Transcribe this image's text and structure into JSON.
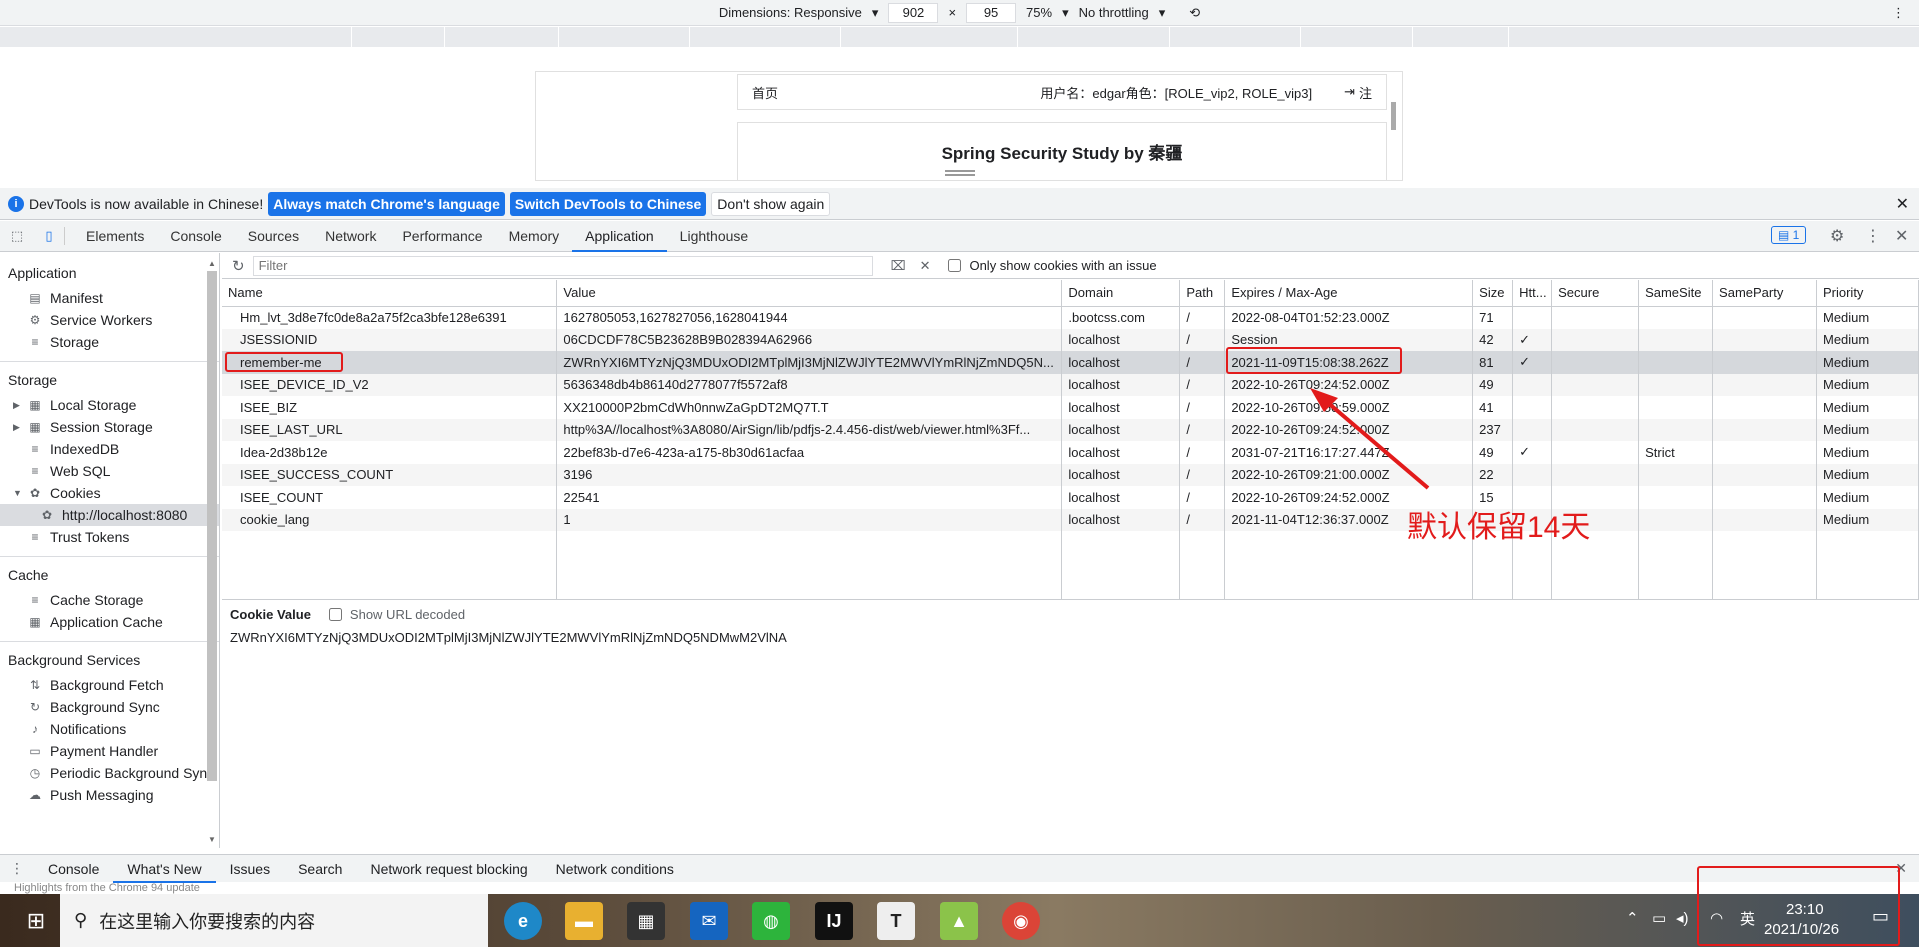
{
  "device_toolbar": {
    "dimensions_label": "Dimensions: Responsive",
    "width": "902",
    "height": "95",
    "times": "×",
    "zoom": "75%",
    "throttling": "No throttling"
  },
  "page": {
    "nav_home": "首页",
    "user_info": "用户名：edgar角色：[ROLE_vip2, ROLE_vip3]",
    "logout_partial": "注",
    "title": "Spring Security Study by 秦疆"
  },
  "infobar": {
    "message": "DevTools is now available in Chinese!",
    "btn_match": "Always match Chrome's language",
    "btn_switch": "Switch DevTools to Chinese",
    "btn_dont": "Don't show again"
  },
  "tabs": [
    "Elements",
    "Console",
    "Sources",
    "Network",
    "Performance",
    "Memory",
    "Application",
    "Lighthouse"
  ],
  "issues_badge": "1",
  "sidebar": {
    "application_header": "Application",
    "application_items": [
      "Manifest",
      "Service Workers",
      "Storage"
    ],
    "storage_header": "Storage",
    "storage_items": [
      "Local Storage",
      "Session Storage",
      "IndexedDB",
      "Web SQL",
      "Cookies"
    ],
    "cookie_origin": "http://localhost:8080",
    "trust_tokens": "Trust Tokens",
    "cache_header": "Cache",
    "cache_items": [
      "Cache Storage",
      "Application Cache"
    ],
    "bg_header": "Background Services",
    "bg_items": [
      "Background Fetch",
      "Background Sync",
      "Notifications",
      "Payment Handler",
      "Periodic Background Sync",
      "Push Messaging"
    ]
  },
  "filter": {
    "placeholder": "Filter",
    "only_issues": "Only show cookies with an issue"
  },
  "table": {
    "columns": [
      "Name",
      "Value",
      "Domain",
      "Path",
      "Expires / Max-Age",
      "Size",
      "Htt...",
      "Secure",
      "SameSite",
      "SameParty",
      "Priority"
    ],
    "rows": [
      [
        "Hm_lvt_3d8e7fc0de8a2a75f2ca3bfe128e6391",
        "1627805053,1627827056,1628041944",
        ".bootcss.com",
        "/",
        "2022-08-04T01:52:23.000Z",
        "71",
        "",
        "",
        "",
        "",
        "Medium"
      ],
      [
        "JSESSIONID",
        "06CDCDF78C5B23628B9B028394A62966",
        "localhost",
        "/",
        "Session",
        "42",
        "✓",
        "",
        "",
        "",
        "Medium"
      ],
      [
        "remember-me",
        "ZWRnYXI6MTYzNjQ3MDUxODI2MTplMjI3MjNlZWJlYTE2MWVlYmRlNjZmNDQ5N...",
        "localhost",
        "/",
        "2021-11-09T15:08:38.262Z",
        "81",
        "✓",
        "",
        "",
        "",
        "Medium"
      ],
      [
        "ISEE_DEVICE_ID_V2",
        "5636348db4b86140d2778077f5572af8",
        "localhost",
        "/",
        "2022-10-26T09:24:52.000Z",
        "49",
        "",
        "",
        "",
        "",
        "Medium"
      ],
      [
        "ISEE_BIZ",
        "XX210000P2bmCdWh0nnwZaGpDT2MQ7T.T",
        "localhost",
        "/",
        "2022-10-26T09:50:59.000Z",
        "41",
        "",
        "",
        "",
        "",
        "Medium"
      ],
      [
        "ISEE_LAST_URL",
        "http%3A//localhost%3A8080/AirSign/lib/pdfjs-2.4.456-dist/web/viewer.html%3Ff...",
        "localhost",
        "/",
        "2022-10-26T09:24:52.000Z",
        "237",
        "",
        "",
        "",
        "",
        "Medium"
      ],
      [
        "Idea-2d38b12e",
        "22bef83b-d7e6-423a-a175-8b30d61acfaa",
        "localhost",
        "/",
        "2031-07-21T16:17:27.447Z",
        "49",
        "✓",
        "",
        "Strict",
        "",
        "Medium"
      ],
      [
        "ISEE_SUCCESS_COUNT",
        "3196",
        "localhost",
        "/",
        "2022-10-26T09:21:00.000Z",
        "22",
        "",
        "",
        "",
        "",
        "Medium"
      ],
      [
        "ISEE_COUNT",
        "22541",
        "localhost",
        "/",
        "2022-10-26T09:24:52.000Z",
        "15",
        "",
        "",
        "",
        "",
        "Medium"
      ],
      [
        "cookie_lang",
        "1",
        "localhost",
        "/",
        "2021-11-04T12:36:37.000Z",
        "",
        "",
        "",
        "",
        "",
        "Medium"
      ]
    ]
  },
  "cookie_value": {
    "label": "Cookie Value",
    "show_decoded": "Show URL decoded",
    "value": "ZWRnYXI6MTYzNjQ3MDUxODI2MTplMjI3MjNlZWJlYTE2MWVlYmRlNjZmNDQ5NDMwM2VlNA"
  },
  "annotation": "默认保留14天",
  "drawer": {
    "tabs": [
      "Console",
      "What's New",
      "Issues",
      "Search",
      "Network request blocking",
      "Network conditions"
    ],
    "text": "Highlights from the Chrome 94 update"
  },
  "taskbar": {
    "search_placeholder": "在这里输入你要搜索的内容",
    "ime": "英",
    "time": "23:10",
    "date": "2021/10/26"
  }
}
